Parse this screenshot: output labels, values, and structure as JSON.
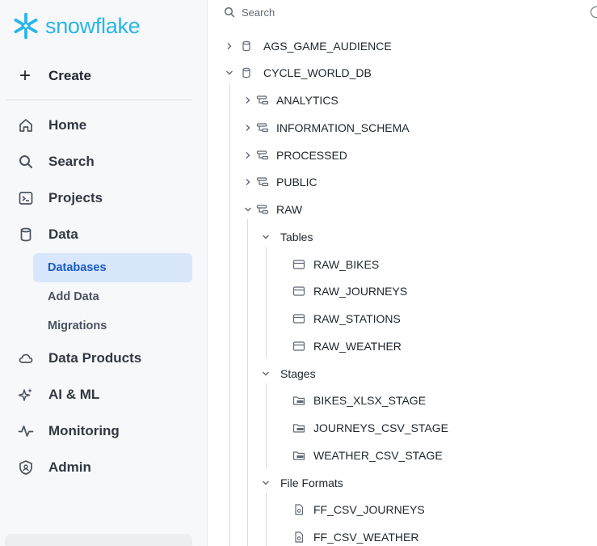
{
  "brand": {
    "name": "snowflake",
    "color": "#29b5e8"
  },
  "sidebar": {
    "create_label": "Create",
    "nav": [
      {
        "label": "Home",
        "icon": "home-icon"
      },
      {
        "label": "Search",
        "icon": "search-icon"
      },
      {
        "label": "Projects",
        "icon": "projects-icon"
      },
      {
        "label": "Data",
        "icon": "database-icon"
      }
    ],
    "data_sub": [
      {
        "label": "Databases",
        "active": true
      },
      {
        "label": "Add Data",
        "active": false
      },
      {
        "label": "Migrations",
        "active": false
      }
    ],
    "nav2": [
      {
        "label": "Data Products",
        "icon": "cloud-icon"
      },
      {
        "label": "AI & ML",
        "icon": "sparkle-icon"
      },
      {
        "label": "Monitoring",
        "icon": "activity-icon"
      },
      {
        "label": "Admin",
        "icon": "shield-icon"
      }
    ]
  },
  "search": {
    "placeholder": "Search"
  },
  "tree": {
    "databases": [
      {
        "name": "AGS_GAME_AUDIENCE",
        "expanded": false
      },
      {
        "name": "CYCLE_WORLD_DB",
        "expanded": true
      }
    ],
    "schemas": [
      {
        "name": "ANALYTICS",
        "expanded": false
      },
      {
        "name": "INFORMATION_SCHEMA",
        "expanded": false
      },
      {
        "name": "PROCESSED",
        "expanded": false
      },
      {
        "name": "PUBLIC",
        "expanded": false
      },
      {
        "name": "RAW",
        "expanded": true
      }
    ],
    "groups": {
      "tables": "Tables",
      "stages": "Stages",
      "file_formats": "File Formats"
    },
    "tables": [
      "RAW_BIKES",
      "RAW_JOURNEYS",
      "RAW_STATIONS",
      "RAW_WEATHER"
    ],
    "stages": [
      "BIKES_XLSX_STAGE",
      "JOURNEYS_CSV_STAGE",
      "WEATHER_CSV_STAGE"
    ],
    "file_formats": [
      "FF_CSV_JOURNEYS",
      "FF_CSV_WEATHER"
    ]
  }
}
